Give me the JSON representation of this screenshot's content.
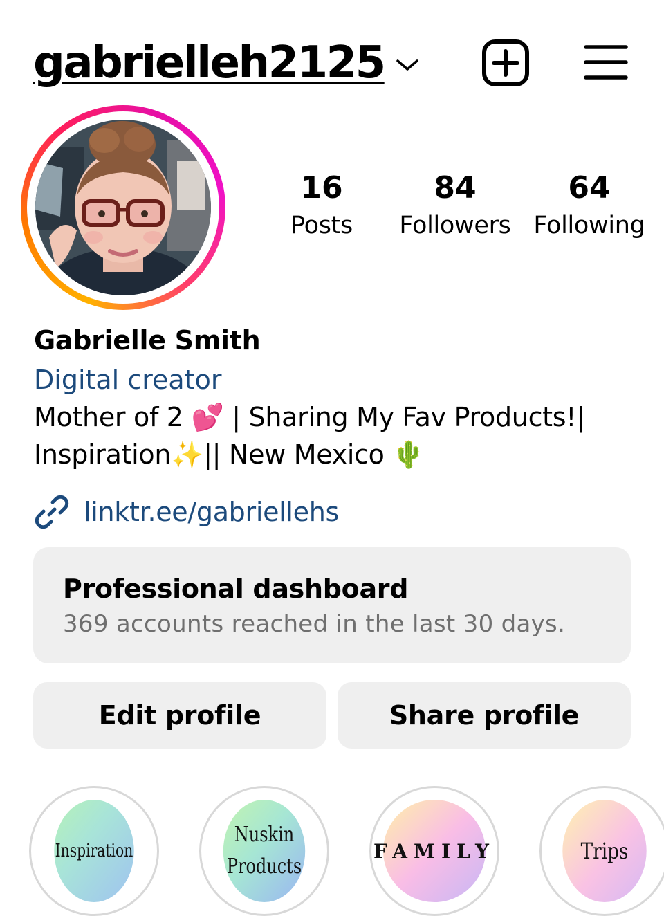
{
  "header": {
    "username": "gabrielleh2125"
  },
  "stats": {
    "posts": {
      "count": "16",
      "label": "Posts"
    },
    "followers": {
      "count": "84",
      "label": "Followers"
    },
    "following": {
      "count": "64",
      "label": "Following"
    }
  },
  "profile": {
    "display_name": "Gabrielle Smith",
    "category": "Digital creator",
    "bio_line1_a": "Mother of 2 ",
    "bio_line1_emoji": "💕",
    "bio_line1_b": " | Sharing My Fav Products!|",
    "bio_line2_a": "Inspiration",
    "bio_line2_emoji": "✨",
    "bio_line2_b": "|| New Mexico ",
    "bio_line2_emoji2": "🌵",
    "link": "linktr.ee/gabriellehs"
  },
  "dashboard": {
    "title": "Professional dashboard",
    "subtitle": "369 accounts reached in the last 30 days."
  },
  "buttons": {
    "edit": "Edit profile",
    "share": "Share profile"
  },
  "highlights": [
    {
      "label": "Inspiration"
    },
    {
      "label_line1": "Nuskin",
      "label_line2": "Products"
    },
    {
      "label": "FAMILY"
    },
    {
      "label": "Trips"
    }
  ],
  "colors": {
    "link_blue": "#1c4a7c",
    "button_gray": "#efefef",
    "secondary_text": "#6f6f6f",
    "story_ring": [
      "#ffb100",
      "#ff1f5a",
      "#f011c6"
    ]
  },
  "icons": {
    "new_post": "plus-square-icon",
    "menu": "hamburger-menu-icon",
    "dropdown": "chevron-down-icon",
    "link": "link-chain-icon"
  }
}
